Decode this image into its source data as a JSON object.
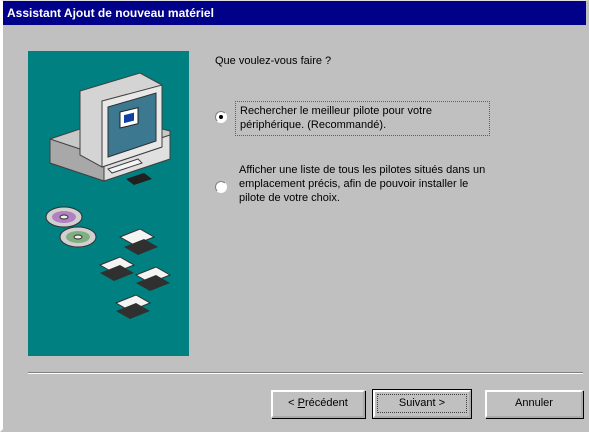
{
  "window": {
    "title": "Assistant Ajout de nouveau matériel"
  },
  "content": {
    "prompt": "Que voulez-vous faire ?",
    "options": [
      {
        "line1": "Rechercher le meilleur pilote pour votre",
        "line2": "périphérique. (Recommandé).",
        "selected": true
      },
      {
        "line1": "Afficher une liste de tous les pilotes situés dans un",
        "line2": "emplacement précis, afin de pouvoir installer le",
        "line3": "pilote de votre choix.",
        "selected": false
      }
    ]
  },
  "buttons": {
    "back_prefix": "< ",
    "back_mnemonic": "P",
    "back_rest": "récédent",
    "next_label": "Suivant >",
    "cancel_label": "Annuler"
  },
  "colors": {
    "titlebar": "#000088",
    "art_background": "#008080",
    "face": "#c0c0c0"
  },
  "icons": [
    "computer-illustration",
    "cd-disc-icon",
    "floppy-disk-icon"
  ]
}
